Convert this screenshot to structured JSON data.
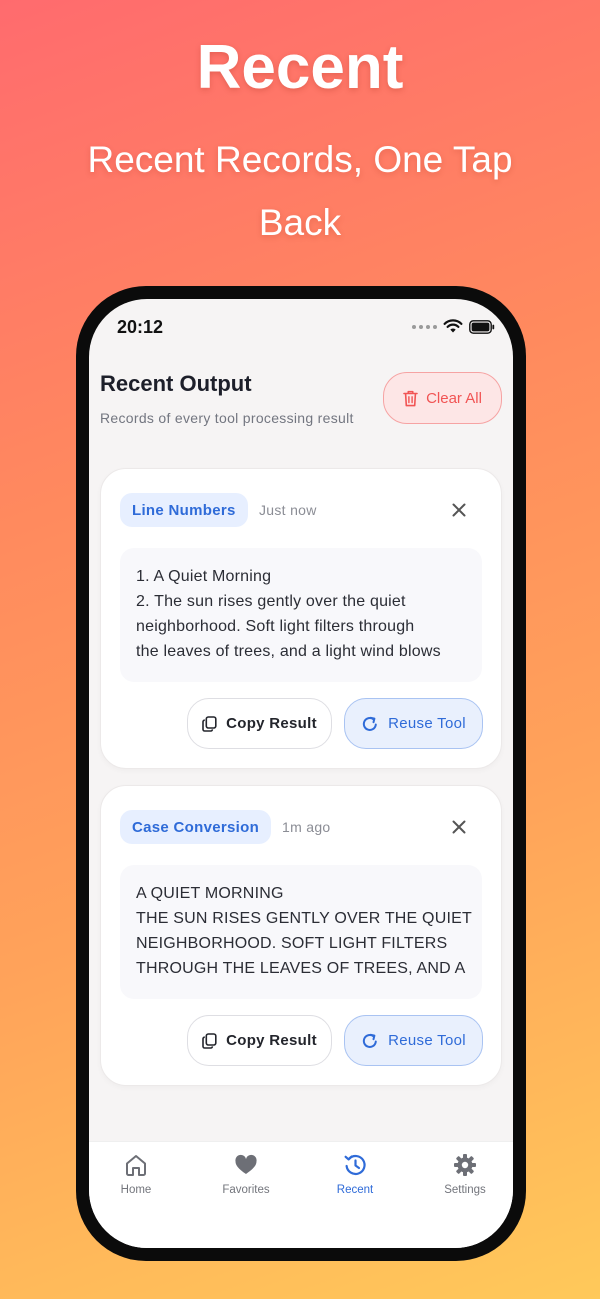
{
  "promo": {
    "headline": "Recent",
    "subline": "Recent Records, One Tap Back"
  },
  "status_bar": {
    "time": "20:12"
  },
  "header": {
    "title": "Recent Output",
    "subtitle": "Records of every tool processing result",
    "clear_label": "Clear All"
  },
  "records": [
    {
      "tool": "Line Numbers",
      "time": "Just now",
      "lines": [
        "1. A Quiet Morning",
        "2. The sun rises gently over the quiet",
        "neighborhood. Soft light filters through",
        "the leaves of trees, and a light wind blows"
      ],
      "copy_label": "Copy Result",
      "reuse_label": "Reuse Tool"
    },
    {
      "tool": "Case Conversion",
      "time": "1m ago",
      "lines": [
        "A QUIET MORNING",
        "THE SUN RISES GENTLY OVER THE QUIET",
        "NEIGHBORHOOD. SOFT LIGHT FILTERS",
        "THROUGH THE LEAVES OF TREES, AND A"
      ],
      "copy_label": "Copy Result",
      "reuse_label": "Reuse Tool"
    }
  ],
  "tabs": [
    {
      "label": "Home",
      "icon": "home-icon"
    },
    {
      "label": "Favorites",
      "icon": "heart-icon"
    },
    {
      "label": "Recent",
      "icon": "history-icon",
      "active": true
    },
    {
      "label": "Settings",
      "icon": "gear-icon"
    }
  ],
  "colors": {
    "accent": "#2f6bd8",
    "danger": "#f15454",
    "tag_bg": "#e7efff"
  }
}
